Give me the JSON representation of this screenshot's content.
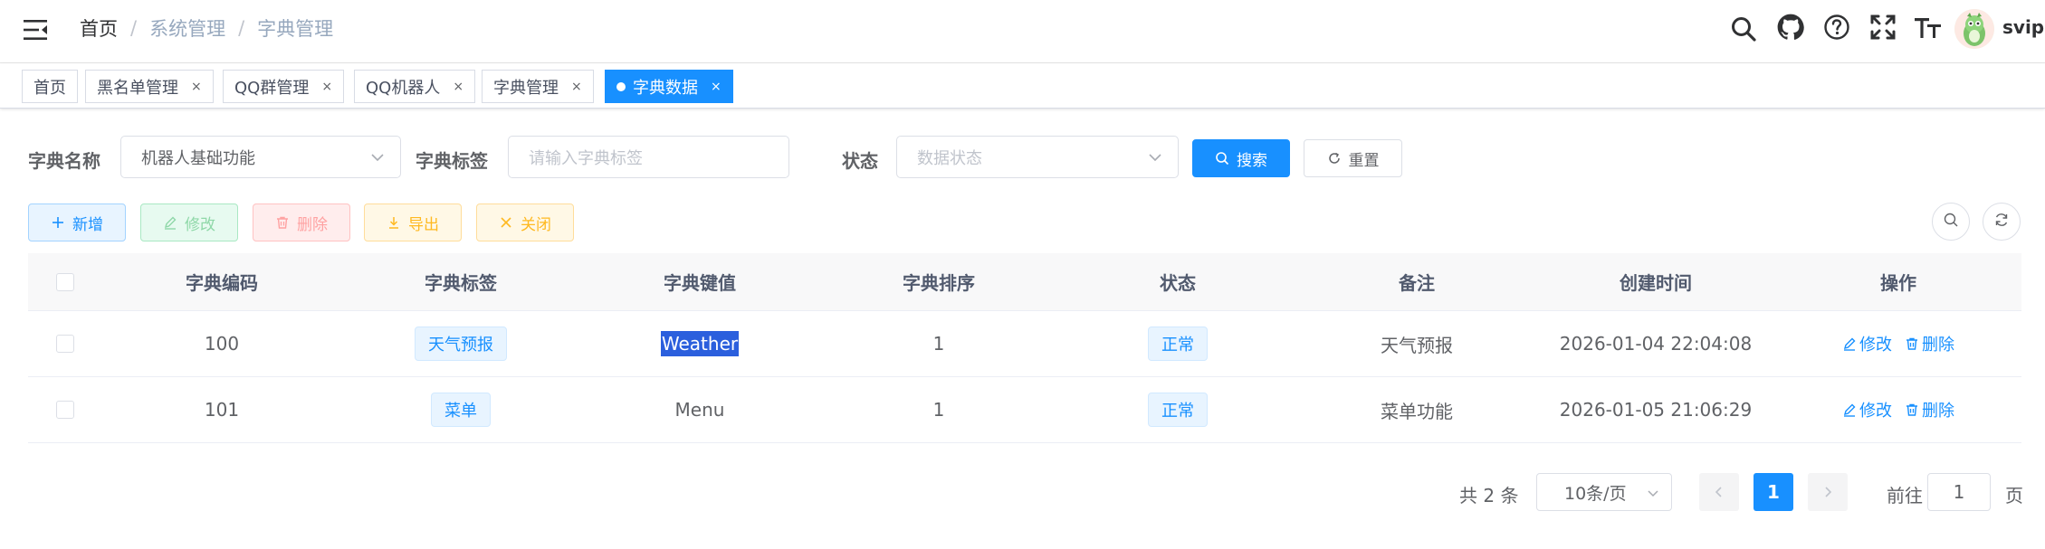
{
  "navbar": {
    "breadcrumb": [
      "首页",
      "系统管理",
      "字典管理"
    ],
    "separator": "/",
    "username": "svip",
    "icons": [
      "search-icon",
      "github-icon",
      "question-icon",
      "fullscreen-icon",
      "font-size-icon"
    ]
  },
  "tags": [
    {
      "label": "首页",
      "closable": false,
      "active": false
    },
    {
      "label": "黑名单管理",
      "closable": true,
      "active": false
    },
    {
      "label": "QQ群管理",
      "closable": true,
      "active": false
    },
    {
      "label": "QQ机器人",
      "closable": true,
      "active": false
    },
    {
      "label": "字典管理",
      "closable": true,
      "active": false
    },
    {
      "label": "字典数据",
      "closable": true,
      "active": true
    }
  ],
  "tag_close": "×",
  "search": {
    "dict_name_label": "字典名称",
    "dict_name_value": "机器人基础功能",
    "dict_label_label": "字典标签",
    "dict_label_placeholder": "请输入字典标签",
    "status_label": "状态",
    "status_placeholder": "数据状态",
    "search_btn": "搜索",
    "reset_btn": "重置"
  },
  "toolbar": {
    "add": "新增",
    "edit": "修改",
    "delete": "删除",
    "export": "导出",
    "close": "关闭"
  },
  "table": {
    "headers": [
      "字典编码",
      "字典标签",
      "字典键值",
      "字典排序",
      "状态",
      "备注",
      "创建时间",
      "操作"
    ],
    "rows": [
      {
        "code": "100",
        "label": "天气预报",
        "value": "Weather",
        "sort": "1",
        "status": "正常",
        "remark": "天气预报",
        "created": "2026-01-04 22:04:08",
        "selected_value": true
      },
      {
        "code": "101",
        "label": "菜单",
        "value": "Menu",
        "sort": "1",
        "status": "正常",
        "remark": "菜单功能",
        "created": "2026-01-05 21:06:29",
        "selected_value": false
      }
    ],
    "op_edit": "修改",
    "op_delete": "删除"
  },
  "pagination": {
    "total_text": "共 2 条",
    "page_size": "10条/页",
    "current_page": "1",
    "goto_label": "前往",
    "goto_value": "1",
    "page_suffix": "页"
  },
  "colors": {
    "primary": "#1890ff",
    "success": "#13ce66",
    "danger": "#ff4949",
    "warning": "#ffba00",
    "selection": "#2b5fdd"
  }
}
